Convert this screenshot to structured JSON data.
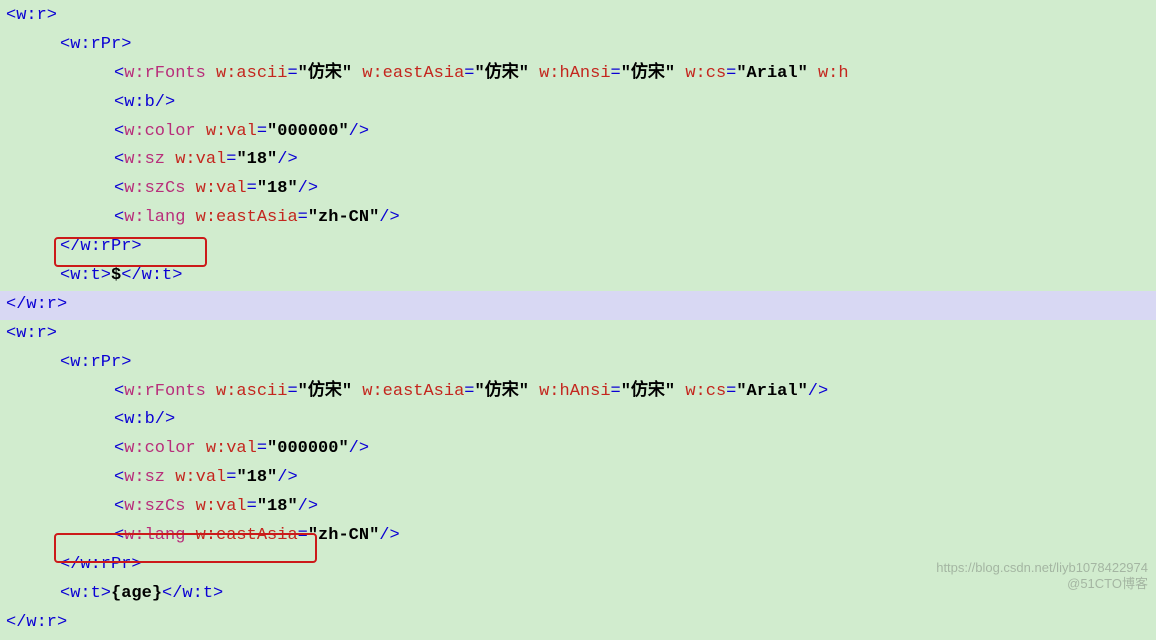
{
  "block1": {
    "open_wr": "<w:r>",
    "open_rpr": "<w:rPr>",
    "rfonts": {
      "tag": "w:rFonts",
      "ascii_attr": "w:ascii",
      "ascii_val": "\"仿宋\"",
      "eastAsia_attr": "w:eastAsia",
      "eastAsia_val": "\"仿宋\"",
      "hAnsi_attr": "w:hAnsi",
      "hAnsi_val": "\"仿宋\"",
      "cs_attr": "w:cs",
      "cs_val": "\"Arial\"",
      "trail_attr": "w:h"
    },
    "b": "<w:b/>",
    "color": {
      "tag": "w:color",
      "attr": "w:val",
      "val": "\"000000\""
    },
    "sz": {
      "tag": "w:sz",
      "attr": "w:val",
      "val": "\"18\""
    },
    "szCs": {
      "tag": "w:szCs",
      "attr": "w:val",
      "val": "\"18\""
    },
    "lang": {
      "tag": "w:lang",
      "attr": "w:eastAsia",
      "val": "\"zh-CN\""
    },
    "close_rpr": "</w:rPr>",
    "wt_open": "<w:t>",
    "wt_text": "$",
    "wt_close": "</w:t>",
    "close_wr": "</w:r>"
  },
  "block2": {
    "open_wr": "<w:r>",
    "open_rpr": "<w:rPr>",
    "rfonts": {
      "tag": "w:rFonts",
      "ascii_attr": "w:ascii",
      "ascii_val": "\"仿宋\"",
      "eastAsia_attr": "w:eastAsia",
      "eastAsia_val": "\"仿宋\"",
      "hAnsi_attr": "w:hAnsi",
      "hAnsi_val": "\"仿宋\"",
      "cs_attr": "w:cs",
      "cs_val": "\"Arial\""
    },
    "b": "<w:b/>",
    "color": {
      "tag": "w:color",
      "attr": "w:val",
      "val": "\"000000\""
    },
    "sz": {
      "tag": "w:sz",
      "attr": "w:val",
      "val": "\"18\""
    },
    "szCs": {
      "tag": "w:szCs",
      "attr": "w:val",
      "val": "\"18\""
    },
    "lang": {
      "tag": "w:lang",
      "attr": "w:eastAsia",
      "val": "\"zh-CN\""
    },
    "close_rpr": "</w:rPr>",
    "wt_open": "<w:t>",
    "wt_text": "{age}",
    "wt_close": "</w:t>",
    "close_wr": "</w:r>"
  },
  "punct": {
    "lt": "<",
    "gt": ">",
    "slashgt": "/>",
    "ltslash": "</",
    "eq": "=",
    "sp": " "
  },
  "watermark": {
    "line1": "https://blog.csdn.net/liyb1078422974",
    "line2": "@51CTO博客"
  }
}
